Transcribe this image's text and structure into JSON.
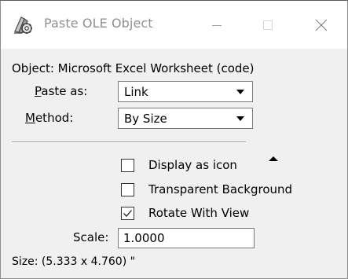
{
  "window": {
    "title": "Paste OLE Object",
    "icon": "paste-ole-icon"
  },
  "caption_buttons": {
    "minimize_icon": "minimize-icon",
    "maximize_icon": "maximize-icon",
    "close_icon": "close-icon"
  },
  "object_line": "Object: Microsoft Excel Worksheet (code)",
  "paste_as": {
    "label_underlined": "P",
    "label_rest": "aste as:",
    "value": "Link"
  },
  "method": {
    "label_underlined": "M",
    "label_rest": "ethod:",
    "value": "By Size"
  },
  "options": [
    {
      "label": "Display as icon",
      "checked": false
    },
    {
      "label": "Transparent Background",
      "checked": false
    },
    {
      "label": "Rotate With View",
      "checked": true
    }
  ],
  "scale": {
    "label": "Scale:",
    "value": "1.0000"
  },
  "size_line": "Size: (5.333 x 4.760) \""
}
